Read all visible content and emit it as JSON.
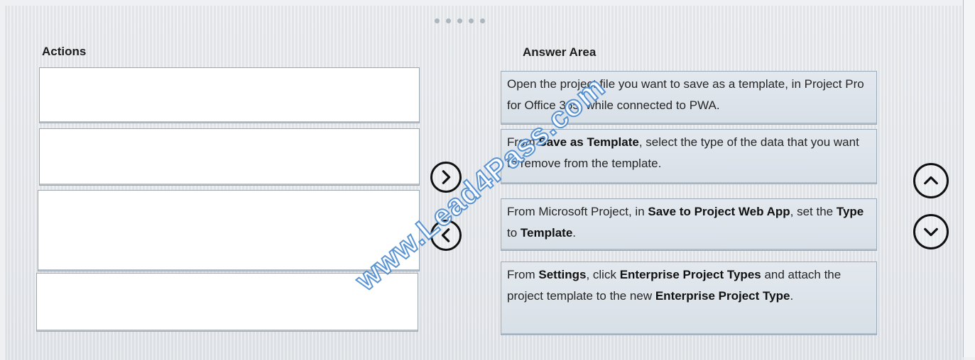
{
  "colors": {
    "panel_bg": "#e4e7ea",
    "answer_box_bg": "#dce4ea",
    "watermark": "#4a8ad0"
  },
  "headings": {
    "actions": "Actions",
    "answer_area": "Answer Area"
  },
  "pager_dots": 5,
  "actions_list": [
    "",
    "",
    "",
    ""
  ],
  "answer_area": [
    {
      "segments": [
        {
          "text": "Open the project file you want to save as a template, in Project Pro for Office 365, while connected to PWA.",
          "bold": false
        }
      ]
    },
    {
      "segments": [
        {
          "text": "From ",
          "bold": false
        },
        {
          "text": "Save as Template",
          "bold": true
        },
        {
          "text": ", select the type of the data that you want to remove from the template.",
          "bold": false
        }
      ]
    },
    {
      "segments": [
        {
          "text": "From Microsoft Project, in ",
          "bold": false
        },
        {
          "text": "Save to Project Web App",
          "bold": true
        },
        {
          "text": ", set the ",
          "bold": false
        },
        {
          "text": "Type",
          "bold": true
        },
        {
          "text": " to ",
          "bold": false
        },
        {
          "text": "Template",
          "bold": true
        },
        {
          "text": ".",
          "bold": false
        }
      ]
    },
    {
      "segments": [
        {
          "text": "From ",
          "bold": false
        },
        {
          "text": "Settings",
          "bold": true
        },
        {
          "text": ", click ",
          "bold": false
        },
        {
          "text": "Enterprise Project Types",
          "bold": true
        },
        {
          "text": " and attach the project template to the new ",
          "bold": false
        },
        {
          "text": "Enterprise Project Type",
          "bold": true
        },
        {
          "text": ".",
          "bold": false
        }
      ]
    }
  ],
  "controls": {
    "move_right_icon": "chevron-right-icon",
    "move_left_icon": "chevron-left-icon",
    "move_up_icon": "chevron-up-icon",
    "move_down_icon": "chevron-down-icon"
  },
  "watermark": {
    "text": "www.Lead4Pass.com"
  }
}
